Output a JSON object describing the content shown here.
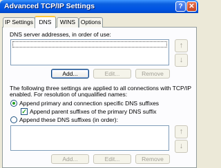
{
  "window": {
    "title": "Advanced TCP/IP Settings",
    "help_glyph": "?",
    "close_glyph": "✕"
  },
  "tabs": [
    {
      "label": "IP Settings"
    },
    {
      "label": "DNS"
    },
    {
      "label": "WINS"
    },
    {
      "label": "Options"
    }
  ],
  "dns": {
    "list_label": "DNS server addresses, in order of use:",
    "buttons": {
      "add": "Add...",
      "edit": "Edit...",
      "remove": "Remove"
    },
    "info_line1": "The following three settings are applied to all connections with TCP/IP",
    "info_line2": "enabled. For resolution of unqualified names:",
    "radio_primary": "Append primary and connection specific DNS suffixes",
    "check_parent": "Append parent suffixes of the primary DNS suffix",
    "radio_these": "Append these DNS suffixes (in order):",
    "buttons2": {
      "add": "Add...",
      "edit": "Edit...",
      "remove": "Remove"
    },
    "selected_option": "primary",
    "parent_checked": true
  },
  "icons": {
    "up_arrow": "↑",
    "down_arrow": "↓"
  }
}
